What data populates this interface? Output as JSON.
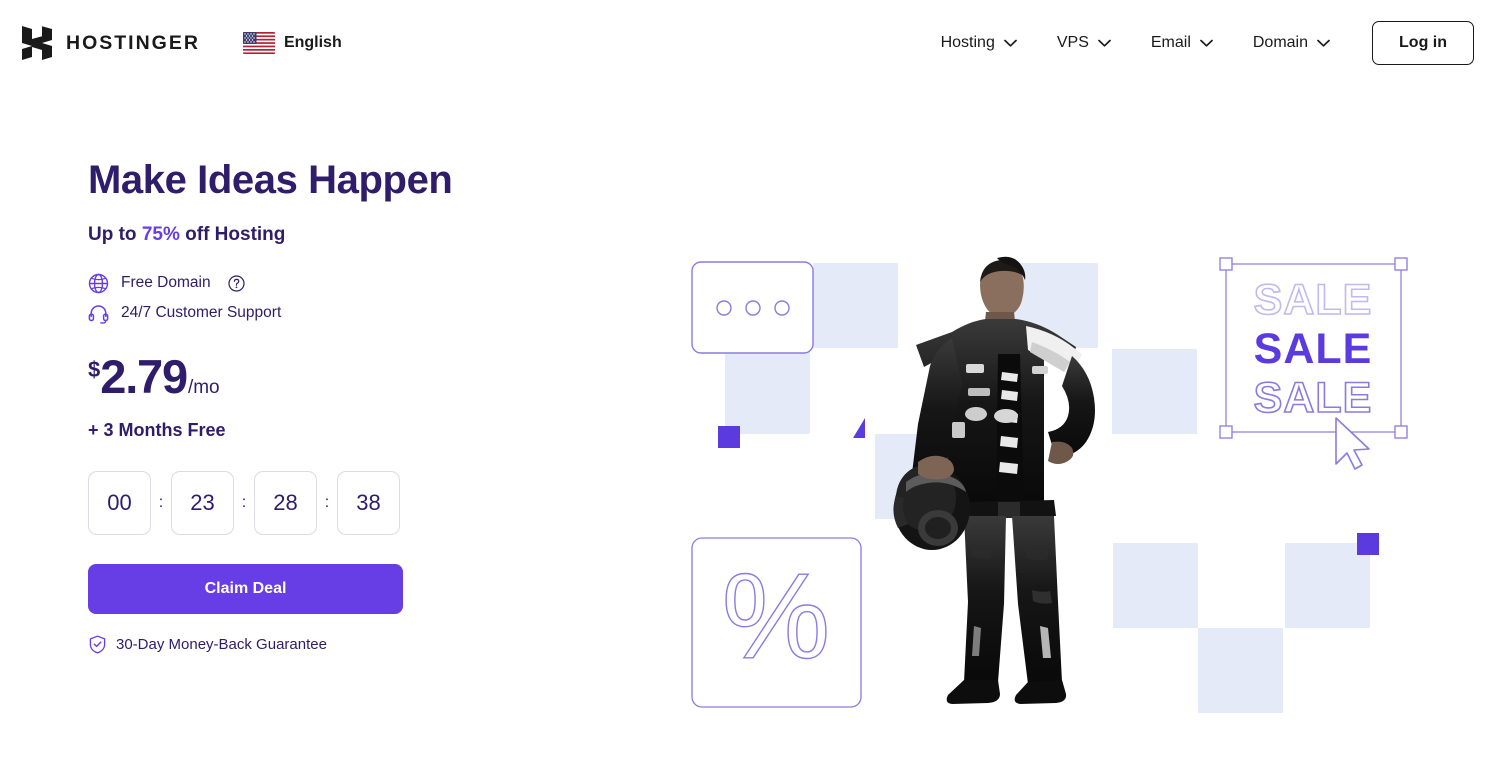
{
  "header": {
    "logo_text": "HOSTINGER",
    "logo_icon": "hostinger-h-mark",
    "language": {
      "label": "English",
      "flag_icon": "us-flag-icon"
    },
    "nav_items": [
      {
        "label": "Hosting",
        "icon": "chevron-down-icon"
      },
      {
        "label": "VPS",
        "icon": "chevron-down-icon"
      },
      {
        "label": "Email",
        "icon": "chevron-down-icon"
      },
      {
        "label": "Domain",
        "icon": "chevron-down-icon"
      }
    ],
    "login_label": "Log in"
  },
  "hero": {
    "heading": "Make Ideas Happen",
    "subheading_prefix": "Up to ",
    "subheading_percent": "75%",
    "subheading_suffix": " off Hosting",
    "features": [
      {
        "icon": "globe-icon",
        "label": "Free Domain",
        "help_icon": "help-circle-icon"
      },
      {
        "icon": "headset-icon",
        "label": "24/7 Customer Support"
      }
    ],
    "price": {
      "currency": "$",
      "amount": "2.79",
      "period": "/mo"
    },
    "bonus": "+ 3 Months Free",
    "countdown": {
      "separator": ":",
      "units": [
        "00",
        "23",
        "28",
        "38"
      ]
    },
    "cta_label": "Claim Deal",
    "guarantee": {
      "icon": "shield-check-icon",
      "label": "30-Day Money-Back Guarantee"
    }
  },
  "illustration": {
    "dots_card_icon": "three-dots-card",
    "percent_card_icon": "percent-symbol-card",
    "sale_texts": [
      "SALE",
      "SALE",
      "SALE"
    ],
    "cursor_icon": "mouse-cursor-icon",
    "person_icon": "racing-driver-photo"
  },
  "colors": {
    "brand_violet": "#673de6",
    "deep_purple": "#2f1c6a",
    "pale_blue": "#e5eaf9",
    "outline_violet": "#8c7ae0",
    "border_gray": "#d9dbe9"
  }
}
